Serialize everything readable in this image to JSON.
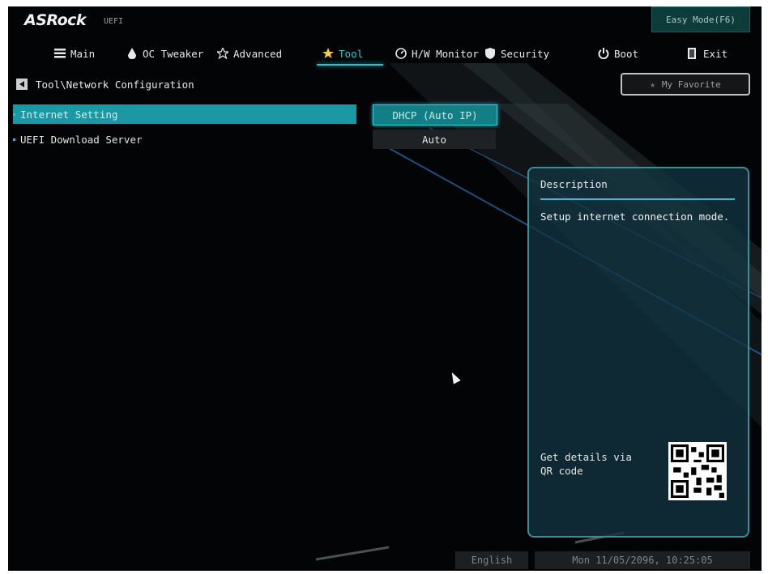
{
  "header": {
    "brand": "ASRock",
    "brand_sub": "UEFI",
    "easy_mode_label": "Easy Mode(F6)"
  },
  "nav": {
    "tabs": [
      {
        "label": "Main",
        "icon": "list-icon"
      },
      {
        "label": "OC Tweaker",
        "icon": "flame-icon"
      },
      {
        "label": "Advanced",
        "icon": "star-icon"
      },
      {
        "label": "Tool",
        "icon": "tool-star-icon",
        "active": true
      },
      {
        "label": "H/W Monitor",
        "icon": "monitor-icon"
      },
      {
        "label": "Security",
        "icon": "shield-icon"
      },
      {
        "label": "Boot",
        "icon": "power-icon"
      },
      {
        "label": "Exit",
        "icon": "exit-icon"
      }
    ]
  },
  "breadcrumb": "Tool\\Network Configuration",
  "favorite_label": "My Favorite",
  "settings": [
    {
      "label": "Internet Setting",
      "value": "DHCP (Auto IP)",
      "selected": true
    },
    {
      "label": "UEFI Download Server",
      "value": "Auto",
      "selected": false
    }
  ],
  "description": {
    "title": "Description",
    "text": "Setup internet connection mode.",
    "qr_text": "Get details via QR code"
  },
  "footer": {
    "language": "English",
    "datetime": "Mon 11/05/2096, 10:25:05"
  },
  "colors": {
    "accent": "#2bbfd0",
    "selected_row": "#1c97a4",
    "panel_border": "#3b8d97"
  }
}
